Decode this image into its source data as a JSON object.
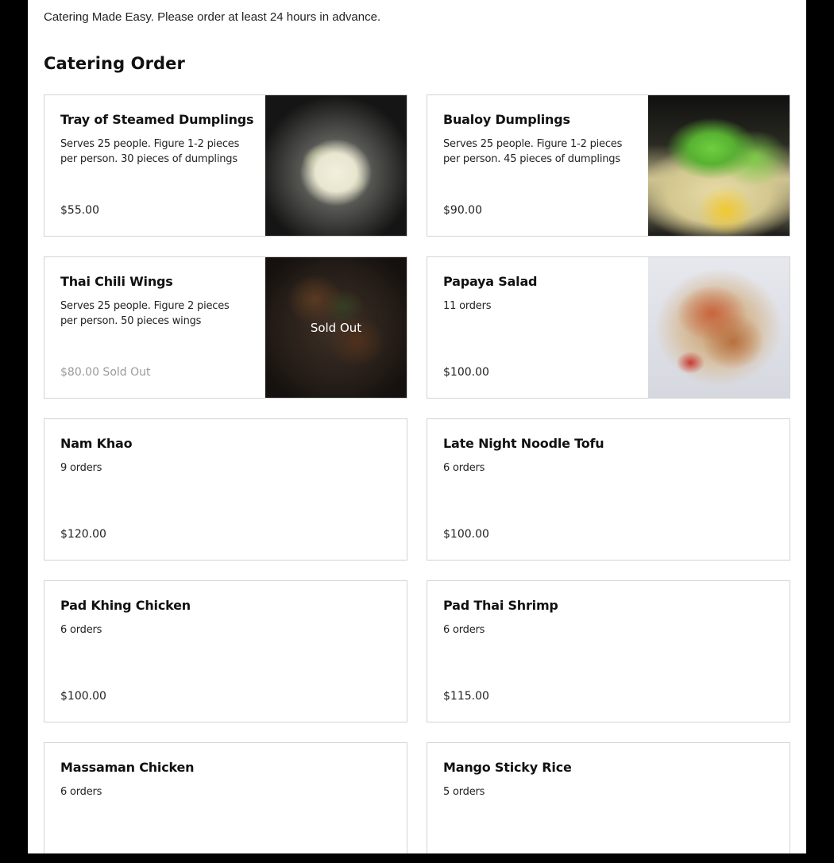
{
  "intro_text": "Catering Made Easy. Please order at least 24 hours in advance.",
  "section_title": "Catering Order",
  "sold_out_overlay": "Sold Out",
  "items": [
    {
      "name": "Tray of Steamed Dumplings",
      "description": "Serves 25 people. Figure 1-2 pieces per person. 30 pieces of dumplings",
      "price": "$55.00"
    },
    {
      "name": "Bualoy Dumplings",
      "description": "Serves 25 people. Figure 1-2 pieces per person. 45 pieces of dumplings",
      "price": "$90.00"
    },
    {
      "name": "Thai Chili Wings",
      "description": "Serves 25 people. Figure 2 pieces per person. 50 pieces wings",
      "price": "$80.00 Sold Out"
    },
    {
      "name": "Papaya Salad",
      "description": "11 orders",
      "price": "$100.00"
    },
    {
      "name": "Nam Khao",
      "description": "9 orders",
      "price": "$120.00"
    },
    {
      "name": "Late Night Noodle Tofu",
      "description": "6 orders",
      "price": "$100.00"
    },
    {
      "name": "Pad Khing Chicken",
      "description": "6 orders",
      "price": "$100.00"
    },
    {
      "name": "Pad Thai Shrimp",
      "description": "6 orders",
      "price": "$115.00"
    },
    {
      "name": "Massaman Chicken",
      "description": "6 orders",
      "price": ""
    },
    {
      "name": "Mango Sticky Rice",
      "description": "5 orders",
      "price": ""
    }
  ]
}
